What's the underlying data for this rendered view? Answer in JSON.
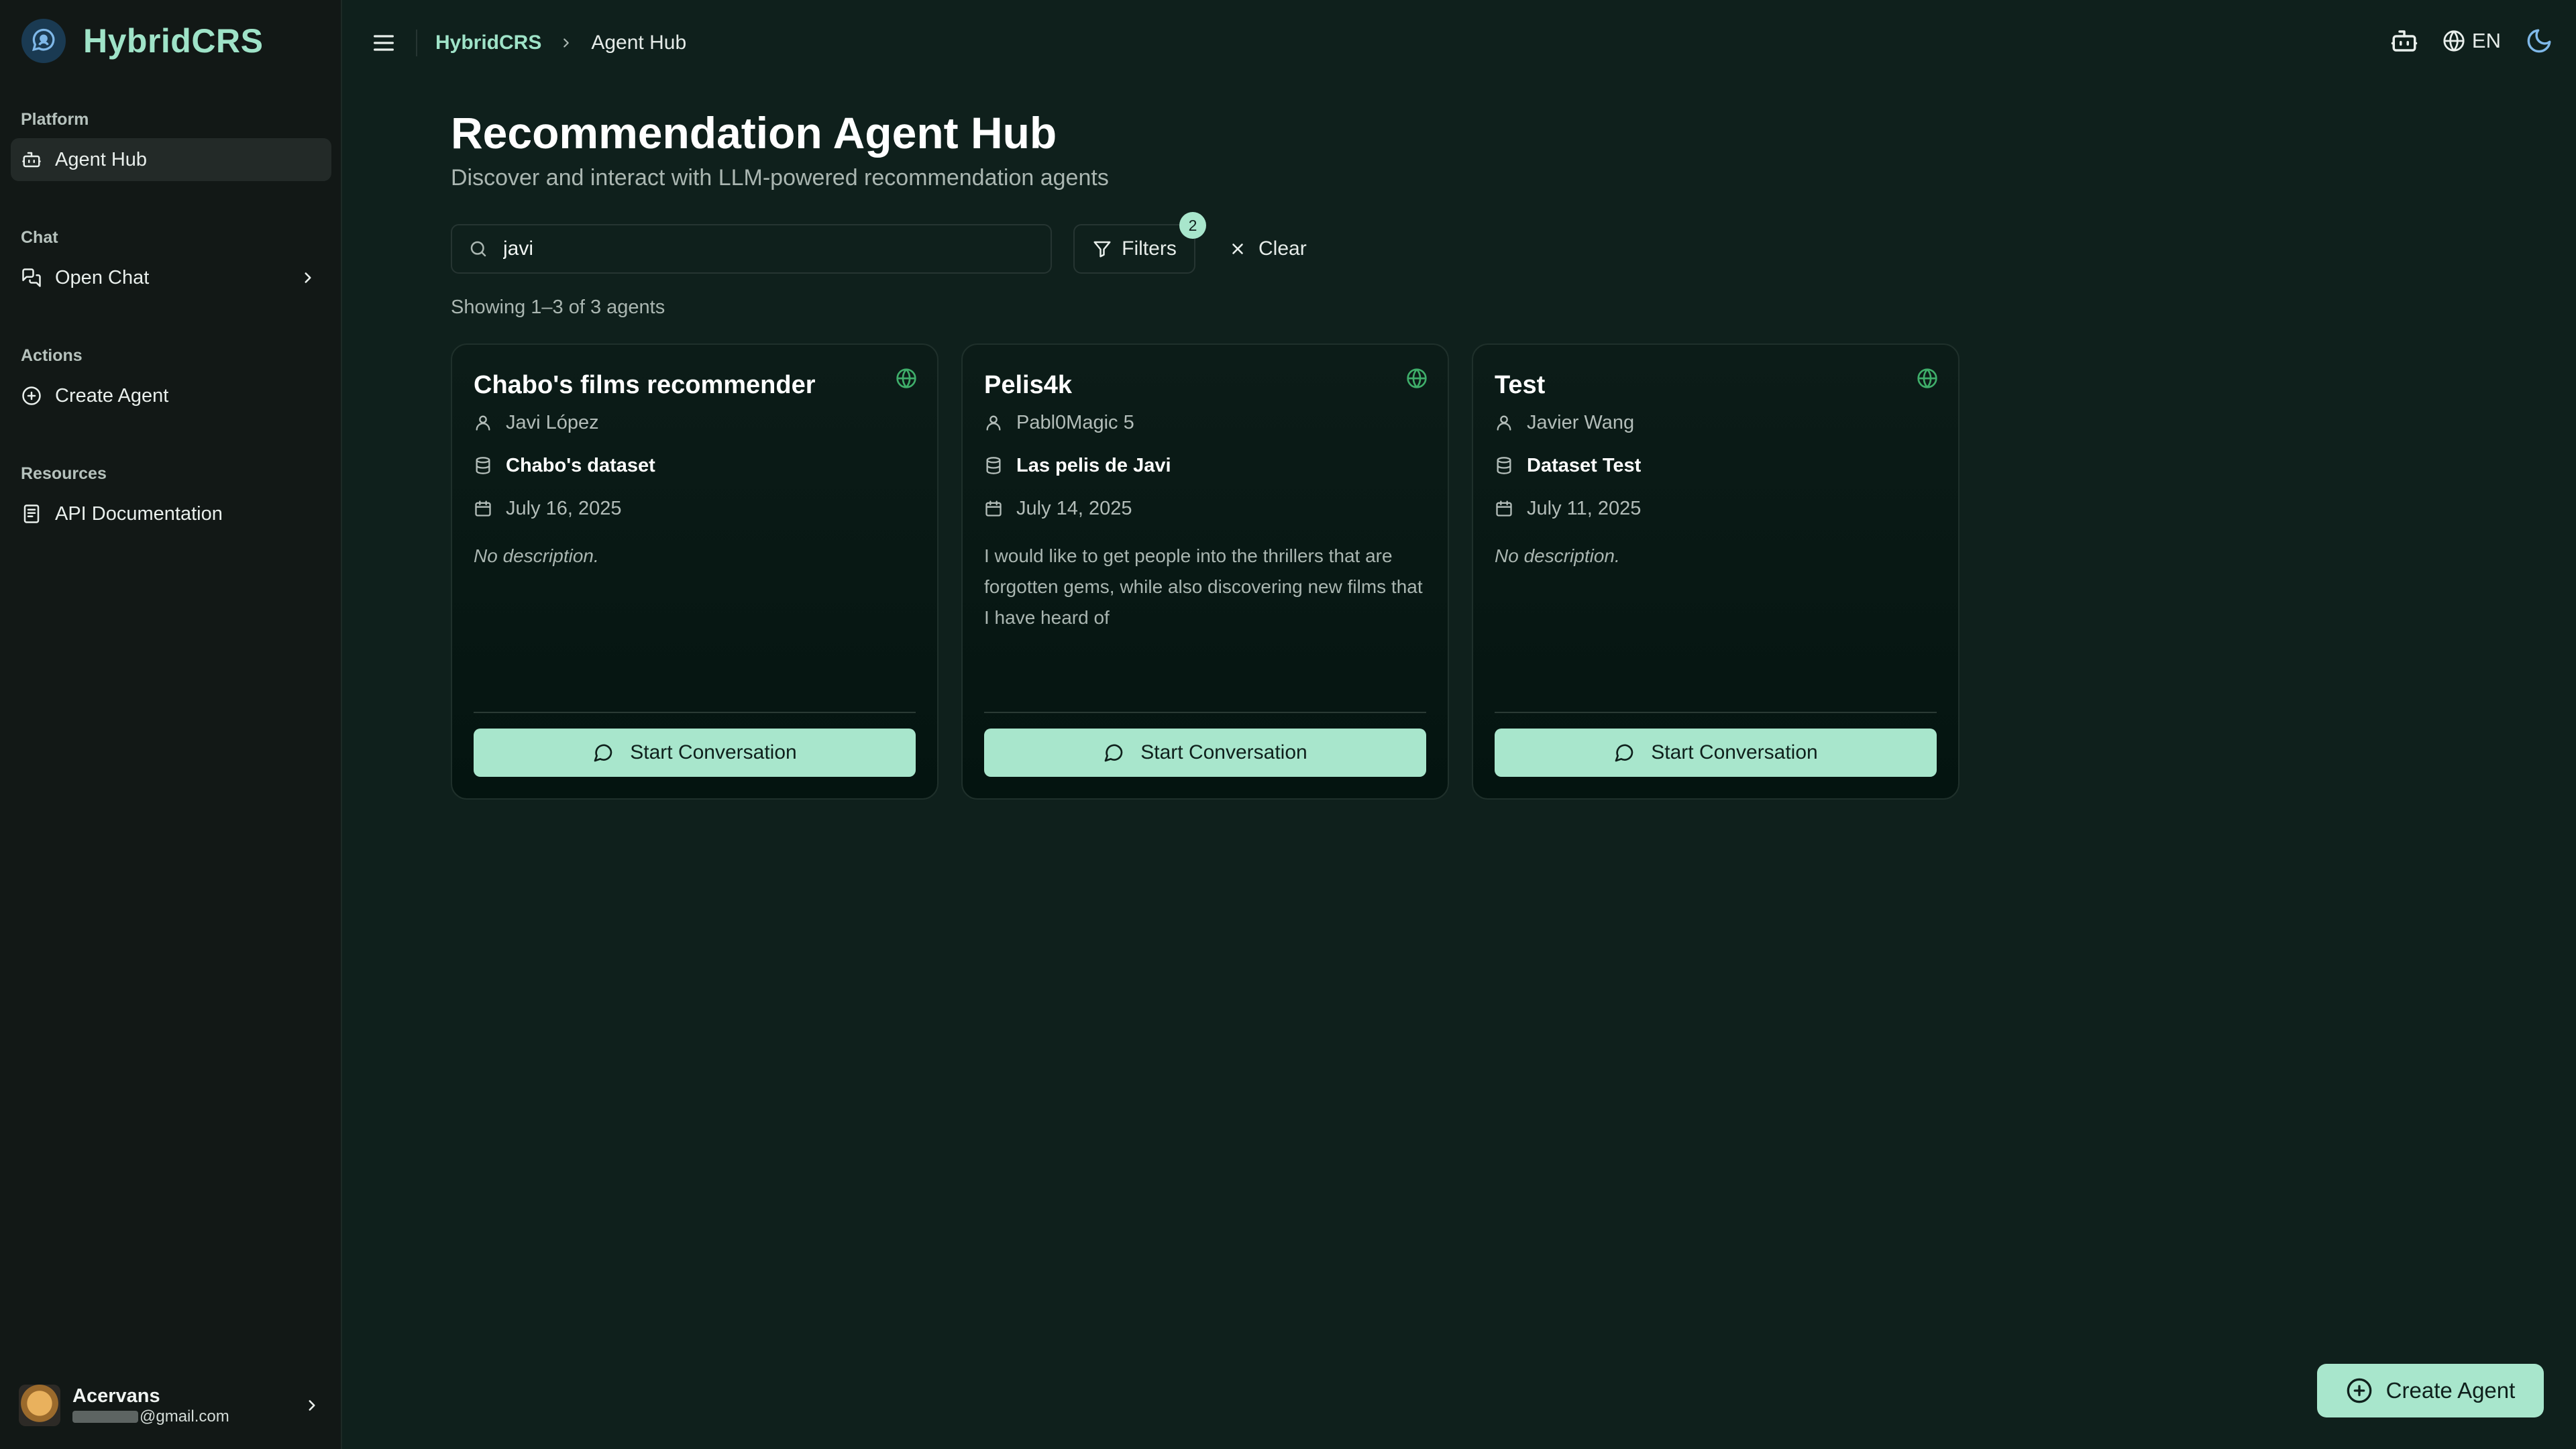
{
  "app": {
    "name": "HybridCRS"
  },
  "sidebar": {
    "sections": [
      {
        "label": "Platform",
        "items": [
          {
            "label": "Agent Hub",
            "icon": "bot-icon",
            "active": true
          }
        ]
      },
      {
        "label": "Chat",
        "items": [
          {
            "label": "Open Chat",
            "icon": "chat-icon",
            "has_chevron": true
          }
        ]
      },
      {
        "label": "Actions",
        "items": [
          {
            "label": "Create Agent",
            "icon": "plus-circle-icon"
          }
        ]
      },
      {
        "label": "Resources",
        "items": [
          {
            "label": "API Documentation",
            "icon": "doc-icon"
          }
        ]
      }
    ],
    "user": {
      "name": "Acervans",
      "email_suffix": "@gmail.com"
    }
  },
  "header": {
    "breadcrumb": [
      "HybridCRS",
      "Agent Hub"
    ],
    "language": "EN"
  },
  "main": {
    "title": "Recommendation Agent Hub",
    "subtitle": "Discover and interact with LLM-powered recommendation agents",
    "search": {
      "value": "javi"
    },
    "filters": {
      "label": "Filters",
      "badge": "2"
    },
    "clear_label": "Clear",
    "count_text": "Showing 1–3 of 3 agents",
    "cards": [
      {
        "title": "Chabo's films recommender",
        "author": "Javi López",
        "dataset": "Chabo's dataset",
        "date": "July 16, 2025",
        "description": "No description.",
        "button": "Start Conversation"
      },
      {
        "title": "Pelis4k",
        "author": "Pabl0Magic 5",
        "dataset": "Las pelis de Javi",
        "date": "July 14, 2025",
        "description": "I would like to get people into the thrillers that are forgotten gems, while also discovering new films that I have heard of",
        "button": "Start Conversation"
      },
      {
        "title": "Test",
        "author": "Javier Wang",
        "dataset": "Dataset Test",
        "date": "July 11, 2025",
        "description": "No description.",
        "button": "Start Conversation"
      }
    ]
  },
  "fab": {
    "label": "Create Agent"
  },
  "colors": {
    "accent": "#a8e6cc",
    "brand_text": "#9fe3c8",
    "background": "#0f201c",
    "sidebar": "#121816",
    "public_globe": "#3fae6a"
  }
}
